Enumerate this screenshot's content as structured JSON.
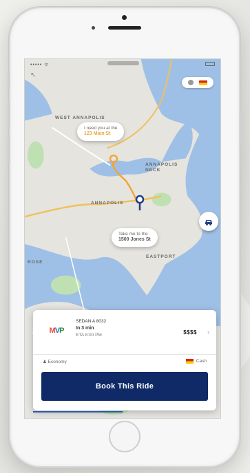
{
  "status_bar": {
    "signal": "••••• ᯤ"
  },
  "top_chip": {
    "flag": "flag-icon"
  },
  "map": {
    "labels": [
      "WEST ANNAPOLIS",
      "ANNAPOLIS",
      "EASTPORT",
      "ANNAPOLIS NECK",
      "ROSE"
    ],
    "colors": {
      "water": "#9fc0e6",
      "land": "#e3e1dc",
      "park": "#bfe0b3",
      "road_major": "#f0c15a",
      "route": "#f2a53a"
    }
  },
  "pickup": {
    "line1": "I need you at the",
    "line2": "123 Main St"
  },
  "destination": {
    "line1": "Take me to the",
    "line2": "1500 Jones St"
  },
  "card": {
    "logo": {
      "m": "M",
      "v": "V",
      "p": "P"
    },
    "vehicle_line1": "SEDAN A 8032",
    "vehicle_line2": "In 3 min",
    "vehicle_line3": "ETA 8:00 PM",
    "price": "$$$$",
    "option_left": "Economy",
    "option_right": "Cash",
    "book_label": "Book This Ride"
  }
}
